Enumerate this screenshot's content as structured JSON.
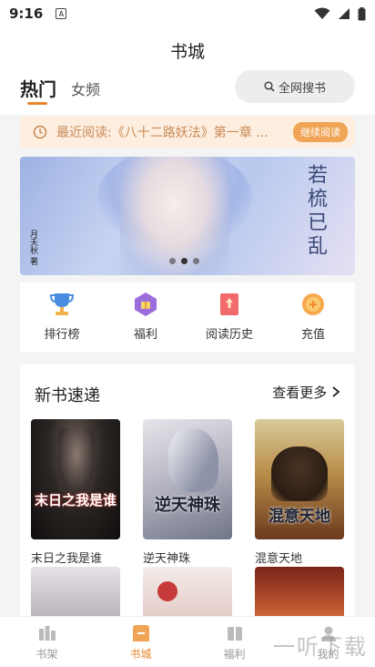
{
  "status": {
    "time": "9:16",
    "app_indicator": "A"
  },
  "header": {
    "title": "书城",
    "tab_hot": "热门",
    "tab_female": "女频",
    "search_label": "全网搜书"
  },
  "recent": {
    "text": "最近阅读:《八十二路妖法》第一章 ...",
    "button": "继续阅读"
  },
  "banner": {
    "calligraphy": "若梳已乱",
    "stamp": "月夭秋 著"
  },
  "shortcuts": [
    {
      "label": "排行榜",
      "icon": "trophy-icon"
    },
    {
      "label": "福利",
      "icon": "gift-icon"
    },
    {
      "label": "阅读历史",
      "icon": "history-icon"
    },
    {
      "label": "充值",
      "icon": "coin-icon"
    }
  ],
  "new_books": {
    "title": "新书速递",
    "more": "查看更多",
    "books": [
      {
        "name": "末日之我是谁",
        "cover_text": "末日之我是谁"
      },
      {
        "name": "逆天神珠",
        "cover_text": "逆天神珠"
      },
      {
        "name": "混意天地",
        "cover_text": "混意天地"
      }
    ]
  },
  "nav": [
    {
      "label": "书架",
      "icon": "bookshelf-icon"
    },
    {
      "label": "书城",
      "icon": "bookstore-icon"
    },
    {
      "label": "福利",
      "icon": "welfare-icon"
    },
    {
      "label": "我的",
      "icon": "profile-icon"
    }
  ],
  "watermark": "一听下载",
  "colors": {
    "accent": "#e8862c",
    "recent_bg": "#fdeee0",
    "continue_btn": "#f0a456"
  }
}
